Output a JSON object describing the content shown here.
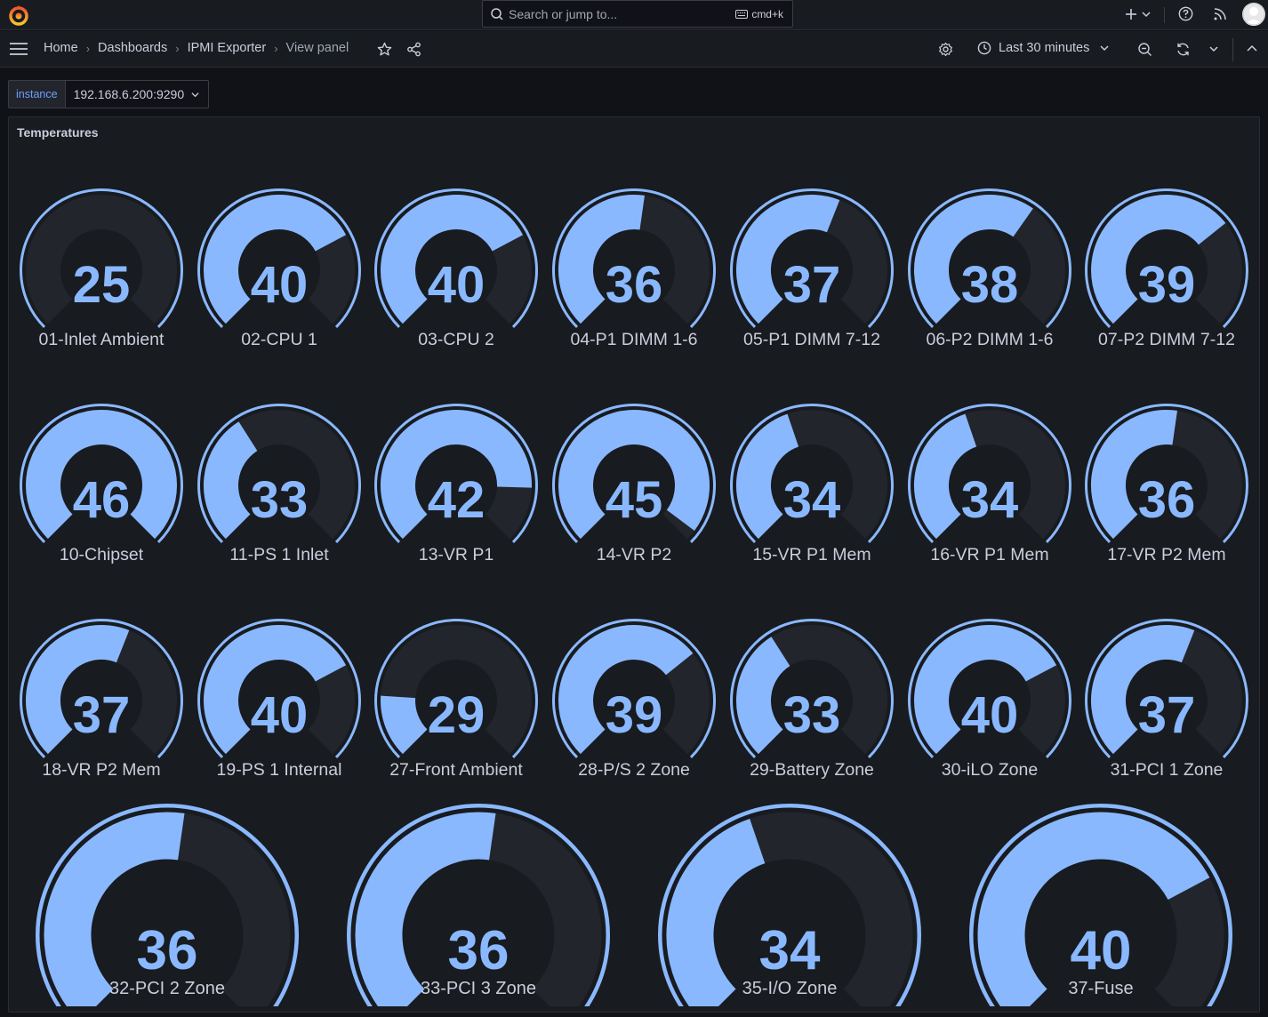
{
  "topbar": {
    "search_placeholder": "Search or jump to...",
    "search_shortcut": "cmd+k"
  },
  "breadcrumb": {
    "items": [
      "Home",
      "Dashboards",
      "IPMI Exporter",
      "View panel"
    ]
  },
  "time_picker": {
    "label": "Last 30 minutes"
  },
  "variable": {
    "label": "instance",
    "value": "192.168.6.200:9290"
  },
  "panel": {
    "title": "Temperatures"
  },
  "colors": {
    "gauge_fill": "#8ab8ff",
    "gauge_track": "#22252b",
    "background": "#111217",
    "panel": "#181b1f"
  },
  "gauges": [
    {
      "label": "01-Inlet Ambient",
      "value": 25,
      "fill": 0.0
    },
    {
      "label": "02-CPU 1",
      "value": 40,
      "fill": 0.73
    },
    {
      "label": "03-CPU 2",
      "value": 40,
      "fill": 0.73
    },
    {
      "label": "04-P1 DIMM 1-6",
      "value": 36,
      "fill": 0.53
    },
    {
      "label": "05-P1 DIMM 7-12",
      "value": 37,
      "fill": 0.58
    },
    {
      "label": "06-P2 DIMM 1-6",
      "value": 38,
      "fill": 0.63
    },
    {
      "label": "07-P2 DIMM 7-12",
      "value": 39,
      "fill": 0.69
    },
    {
      "label": "10-Chipset",
      "value": 46,
      "fill": 1.0
    },
    {
      "label": "11-PS 1 Inlet",
      "value": 33,
      "fill": 0.38
    },
    {
      "label": "13-VR P1",
      "value": 42,
      "fill": 0.84
    },
    {
      "label": "14-VR P2",
      "value": 45,
      "fill": 0.97
    },
    {
      "label": "15-VR P1 Mem",
      "value": 34,
      "fill": 0.43
    },
    {
      "label": "16-VR P1 Mem",
      "value": 34,
      "fill": 0.43
    },
    {
      "label": "17-VR P2 Mem",
      "value": 36,
      "fill": 0.53
    },
    {
      "label": "18-VR P2 Mem",
      "value": 37,
      "fill": 0.58
    },
    {
      "label": "19-PS 1 Internal",
      "value": 40,
      "fill": 0.73
    },
    {
      "label": "27-Front Ambient",
      "value": 29,
      "fill": 0.18
    },
    {
      "label": "28-P/S 2 Zone",
      "value": 39,
      "fill": 0.69
    },
    {
      "label": "29-Battery Zone",
      "value": 33,
      "fill": 0.38
    },
    {
      "label": "30-iLO Zone",
      "value": 40,
      "fill": 0.73
    },
    {
      "label": "31-PCI 1 Zone",
      "value": 37,
      "fill": 0.58
    },
    {
      "label": "32-PCI 2 Zone",
      "value": 36,
      "fill": 0.53
    },
    {
      "label": "33-PCI 3 Zone",
      "value": 36,
      "fill": 0.53
    },
    {
      "label": "35-I/O Zone",
      "value": 34,
      "fill": 0.43
    },
    {
      "label": "37-Fuse",
      "value": 40,
      "fill": 0.73
    }
  ]
}
